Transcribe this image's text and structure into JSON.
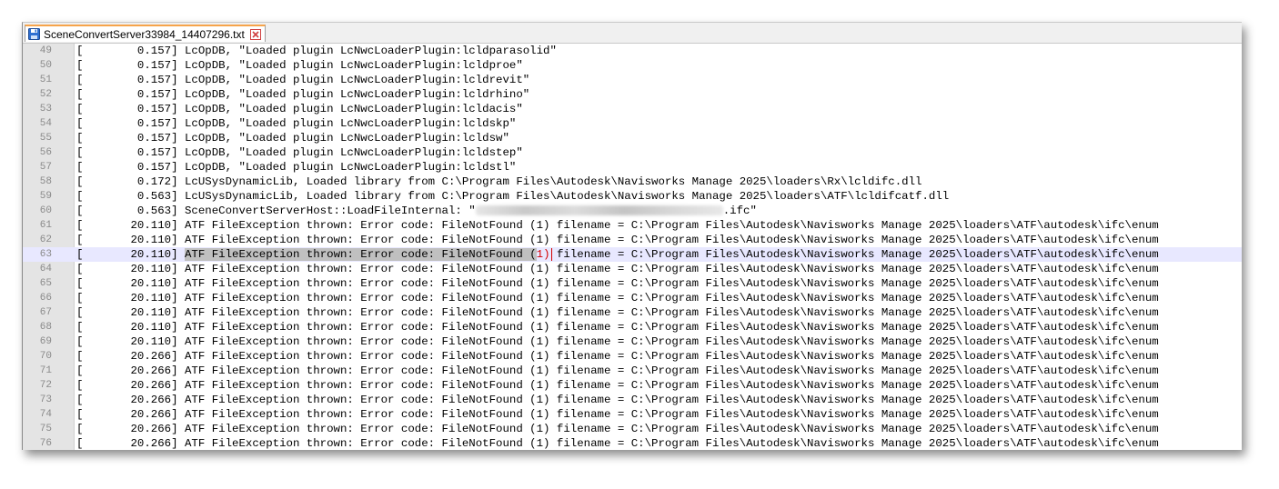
{
  "tab": {
    "title": "SceneConvertServer33984_14407296.txt",
    "icon": "save-icon",
    "close_icon": "close-icon"
  },
  "colors": {
    "tab_accent": "#f6a44b",
    "gutter_bg": "#e4e4e4",
    "current_line_bg": "#e8e8ff",
    "selection_bg": "#c0c0c0",
    "caret": "#d40000"
  },
  "current_line": 63,
  "lines": [
    {
      "n": "49",
      "text": "[        0.157] LcOpDB, \"Loaded plugin LcNwcLoaderPlugin:lcldparasolid\""
    },
    {
      "n": "50",
      "text": "[        0.157] LcOpDB, \"Loaded plugin LcNwcLoaderPlugin:lcldproe\""
    },
    {
      "n": "51",
      "text": "[        0.157] LcOpDB, \"Loaded plugin LcNwcLoaderPlugin:lcldrevit\""
    },
    {
      "n": "52",
      "text": "[        0.157] LcOpDB, \"Loaded plugin LcNwcLoaderPlugin:lcldrhino\""
    },
    {
      "n": "53",
      "text": "[        0.157] LcOpDB, \"Loaded plugin LcNwcLoaderPlugin:lcldacis\""
    },
    {
      "n": "54",
      "text": "[        0.157] LcOpDB, \"Loaded plugin LcNwcLoaderPlugin:lcldskp\""
    },
    {
      "n": "55",
      "text": "[        0.157] LcOpDB, \"Loaded plugin LcNwcLoaderPlugin:lcldsw\""
    },
    {
      "n": "56",
      "text": "[        0.157] LcOpDB, \"Loaded plugin LcNwcLoaderPlugin:lcldstep\""
    },
    {
      "n": "57",
      "text": "[        0.157] LcOpDB, \"Loaded plugin LcNwcLoaderPlugin:lcldstl\""
    },
    {
      "n": "58",
      "text": "[        0.172] LcUSysDynamicLib, Loaded library from C:\\Program Files\\Autodesk\\Navisworks Manage 2025\\loaders\\Rx\\lcldifc.dll"
    },
    {
      "n": "59",
      "text": "[        0.563] LcUSysDynamicLib, Loaded library from C:\\Program Files\\Autodesk\\Navisworks Manage 2025\\loaders\\ATF\\lcldifcatf.dll"
    },
    {
      "n": "60",
      "text_before": "[        0.563] SceneConvertServerHost::LoadFileInternal: \"",
      "text_after": ".ifc\""
    },
    {
      "n": "61",
      "text": "[       20.110] ATF FileException thrown: Error code: FileNotFound (1) filename = C:\\Program Files\\Autodesk\\Navisworks Manage 2025\\loaders\\ATF\\autodesk\\ifc\\enum"
    },
    {
      "n": "62",
      "text": "[       20.110] ATF FileException thrown: Error code: FileNotFound (1) filename = C:\\Program Files\\Autodesk\\Navisworks Manage 2025\\loaders\\ATF\\autodesk\\ifc\\enum"
    },
    {
      "n": "63",
      "prefix": "[       20.110] ",
      "selected": "ATF FileException thrown: Error code: FileNotFound (",
      "bracket_open": "",
      "red": "1)",
      "after": " filename = C:\\Program Files\\Autodesk\\Navisworks Manage 2025\\loaders\\ATF\\autodesk\\ifc\\enum"
    },
    {
      "n": "64",
      "text": "[       20.110] ATF FileException thrown: Error code: FileNotFound (1) filename = C:\\Program Files\\Autodesk\\Navisworks Manage 2025\\loaders\\ATF\\autodesk\\ifc\\enum"
    },
    {
      "n": "65",
      "text": "[       20.110] ATF FileException thrown: Error code: FileNotFound (1) filename = C:\\Program Files\\Autodesk\\Navisworks Manage 2025\\loaders\\ATF\\autodesk\\ifc\\enum"
    },
    {
      "n": "66",
      "text": "[       20.110] ATF FileException thrown: Error code: FileNotFound (1) filename = C:\\Program Files\\Autodesk\\Navisworks Manage 2025\\loaders\\ATF\\autodesk\\ifc\\enum"
    },
    {
      "n": "67",
      "text": "[       20.110] ATF FileException thrown: Error code: FileNotFound (1) filename = C:\\Program Files\\Autodesk\\Navisworks Manage 2025\\loaders\\ATF\\autodesk\\ifc\\enum"
    },
    {
      "n": "68",
      "text": "[       20.110] ATF FileException thrown: Error code: FileNotFound (1) filename = C:\\Program Files\\Autodesk\\Navisworks Manage 2025\\loaders\\ATF\\autodesk\\ifc\\enum"
    },
    {
      "n": "69",
      "text": "[       20.110] ATF FileException thrown: Error code: FileNotFound (1) filename = C:\\Program Files\\Autodesk\\Navisworks Manage 2025\\loaders\\ATF\\autodesk\\ifc\\enum"
    },
    {
      "n": "70",
      "text": "[       20.266] ATF FileException thrown: Error code: FileNotFound (1) filename = C:\\Program Files\\Autodesk\\Navisworks Manage 2025\\loaders\\ATF\\autodesk\\ifc\\enum"
    },
    {
      "n": "71",
      "text": "[       20.266] ATF FileException thrown: Error code: FileNotFound (1) filename = C:\\Program Files\\Autodesk\\Navisworks Manage 2025\\loaders\\ATF\\autodesk\\ifc\\enum"
    },
    {
      "n": "72",
      "text": "[       20.266] ATF FileException thrown: Error code: FileNotFound (1) filename = C:\\Program Files\\Autodesk\\Navisworks Manage 2025\\loaders\\ATF\\autodesk\\ifc\\enum"
    },
    {
      "n": "73",
      "text": "[       20.266] ATF FileException thrown: Error code: FileNotFound (1) filename = C:\\Program Files\\Autodesk\\Navisworks Manage 2025\\loaders\\ATF\\autodesk\\ifc\\enum"
    },
    {
      "n": "74",
      "text": "[       20.266] ATF FileException thrown: Error code: FileNotFound (1) filename = C:\\Program Files\\Autodesk\\Navisworks Manage 2025\\loaders\\ATF\\autodesk\\ifc\\enum"
    },
    {
      "n": "75",
      "text": "[       20.266] ATF FileException thrown: Error code: FileNotFound (1) filename = C:\\Program Files\\Autodesk\\Navisworks Manage 2025\\loaders\\ATF\\autodesk\\ifc\\enum"
    },
    {
      "n": "76",
      "text": "[       20.266] ATF FileException thrown: Error code: FileNotFound (1) filename = C:\\Program Files\\Autodesk\\Navisworks Manage 2025\\loaders\\ATF\\autodesk\\ifc\\enum"
    }
  ]
}
